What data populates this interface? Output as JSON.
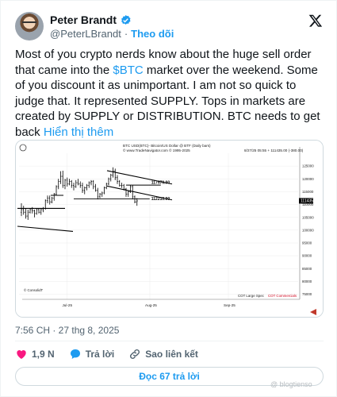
{
  "author": {
    "name": "Peter Brandt",
    "handle": "@PeterLBrandt",
    "separator": "·",
    "follow_label": "Theo dõi"
  },
  "tweet": {
    "text_before": "Most of you crypto nerds know about the huge sell order that came into the ",
    "cashtag": "$BTC",
    "text_after": " market over the weekend. Some of you discount it as unimportant. I am not so quick to judge that. It represented SUPPLY. Tops in markets are created by SUPPLY or DISTRIBUTION. BTC needs to get back ",
    "show_more": "Hiển thị thêm",
    "timestamp": "7:56 CH · 27 thg 8, 2025"
  },
  "chart": {
    "title_line1": "BTC USD(BTC)- Bitcoin/US Dollar @ BTF (Daily bars)",
    "title_line2": "© www.TradeNavigator.com © 1995-2025",
    "info_right": "8/27/25 05:55 + 111435.00 (-380.00)",
    "level_upper": "117570.00",
    "level_lower": "112210.00",
    "last_price": "111435",
    "watermark_chart": "© ConsolidT",
    "legend_1": "COT Large Spec",
    "legend_2": "COT Commercials",
    "x_ticks": [
      "Jul-25",
      "Aug-25",
      "Sep-25"
    ],
    "y_ticks": [
      "125000",
      "120000",
      "115000",
      "110000",
      "105000",
      "100000",
      "95000",
      "90000",
      "85000",
      "80000",
      "75000"
    ],
    "colors": {
      "bars": "#000000",
      "legend_2": "#d0021b",
      "arrow": "#c0392b"
    }
  },
  "chart_data": {
    "type": "ohlc",
    "ylim": [
      73000,
      130000
    ],
    "y_ticks": [
      75000,
      80000,
      85000,
      90000,
      95000,
      100000,
      105000,
      110000,
      115000,
      120000,
      125000
    ],
    "x_ticks": [
      "Jul-25",
      "Aug-25",
      "Sep-25"
    ],
    "bars": [
      [
        107000,
        110500,
        105500,
        108000
      ],
      [
        108000,
        109500,
        106000,
        107000
      ],
      [
        107000,
        108500,
        104500,
        105500
      ],
      [
        105500,
        108000,
        104000,
        107000
      ],
      [
        107000,
        108500,
        106500,
        108000
      ],
      [
        108000,
        109000,
        106500,
        107500
      ],
      [
        107500,
        108000,
        105000,
        106500
      ],
      [
        106500,
        108500,
        106000,
        108000
      ],
      [
        108000,
        108500,
        106500,
        107000
      ],
      [
        107000,
        108500,
        106000,
        108000
      ],
      [
        108000,
        109000,
        107000,
        108500
      ],
      [
        108500,
        112000,
        108000,
        111500
      ],
      [
        111500,
        113500,
        110500,
        112500
      ],
      [
        112500,
        113500,
        110000,
        111000
      ],
      [
        111000,
        113000,
        110500,
        112500
      ],
      [
        112500,
        114500,
        111500,
        114000
      ],
      [
        114000,
        117500,
        113500,
        117000
      ],
      [
        117000,
        120000,
        116000,
        119000
      ],
      [
        119000,
        123000,
        118000,
        121000
      ],
      [
        121000,
        123200,
        116500,
        117500
      ],
      [
        117500,
        120000,
        116000,
        119500
      ],
      [
        119500,
        120500,
        117000,
        118000
      ],
      [
        118000,
        120000,
        117500,
        119000
      ],
      [
        119000,
        119500,
        116500,
        117500
      ],
      [
        117500,
        118500,
        115500,
        117000
      ],
      [
        117000,
        119500,
        116500,
        118500
      ],
      [
        118500,
        120000,
        117500,
        118000
      ],
      [
        118000,
        119000,
        116500,
        117500
      ],
      [
        117500,
        118500,
        114500,
        115500
      ],
      [
        115500,
        117000,
        114000,
        116500
      ],
      [
        116500,
        118000,
        115500,
        117500
      ],
      [
        117500,
        119000,
        116500,
        118500
      ],
      [
        118500,
        119500,
        117500,
        119000
      ],
      [
        119000,
        119500,
        116000,
        117000
      ],
      [
        117000,
        118000,
        115000,
        115500
      ],
      [
        115500,
        116500,
        112000,
        113000
      ],
      [
        113000,
        114500,
        112500,
        114000
      ],
      [
        114000,
        115000,
        113000,
        114500
      ],
      [
        114500,
        117000,
        114000,
        116500
      ],
      [
        116500,
        118500,
        116000,
        118000
      ],
      [
        118000,
        120500,
        117500,
        120000
      ],
      [
        120000,
        122000,
        119000,
        121500
      ],
      [
        121500,
        124500,
        120500,
        123000
      ],
      [
        123000,
        124000,
        119500,
        120500
      ],
      [
        120500,
        121500,
        118000,
        119000
      ],
      [
        119000,
        119500,
        117000,
        117500
      ],
      [
        117500,
        118500,
        116500,
        117500
      ],
      [
        117500,
        118000,
        115500,
        116000
      ],
      [
        116000,
        116500,
        113000,
        114000
      ],
      [
        114000,
        115500,
        113000,
        115000
      ],
      [
        115000,
        117500,
        114500,
        117000
      ],
      [
        117000,
        117500,
        112000,
        113000
      ],
      [
        113000,
        113500,
        110500,
        111000
      ],
      [
        111000,
        112500,
        109500,
        111435
      ]
    ],
    "levels": [
      117570,
      112210
    ]
  },
  "actions": {
    "likes": "1,9 N",
    "reply_label": "Trả lời",
    "copy_label": "Sao liên kết"
  },
  "replies_button": "Đọc 67 trả lời",
  "page_watermark": "@ blogtienso"
}
